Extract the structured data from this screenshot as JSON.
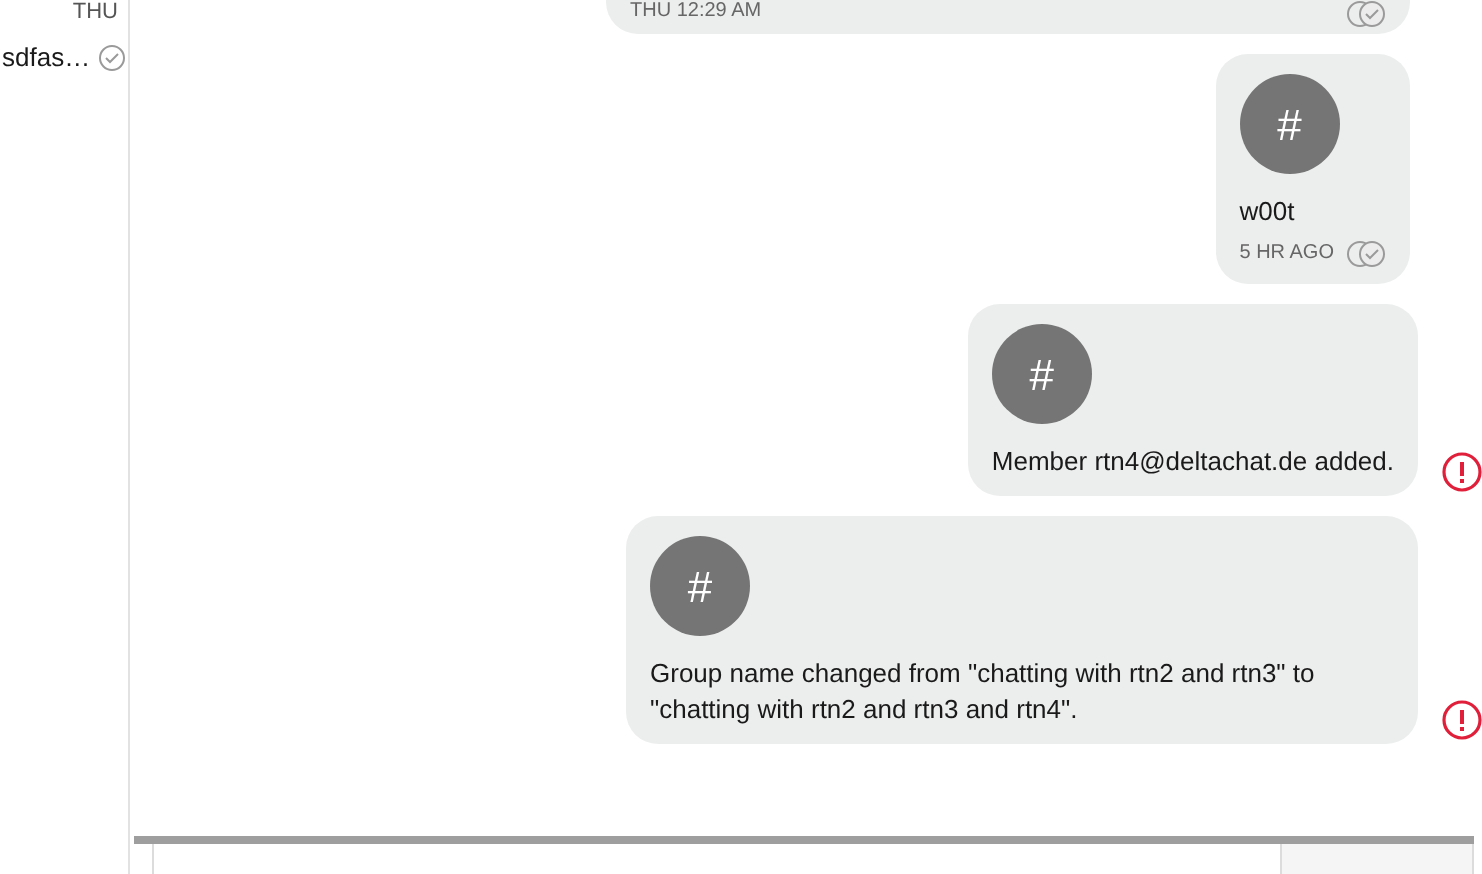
{
  "sidebar": {
    "day": "THU",
    "preview": "sdfas…",
    "delivered": true
  },
  "messages": [
    {
      "kind": "text",
      "time": "THU 12:29 AM",
      "failed": false
    },
    {
      "kind": "group_image",
      "avatar": "#",
      "text": "w00t",
      "time": "5 HR AGO",
      "failed": false
    },
    {
      "kind": "group_image",
      "avatar": "#",
      "text": "Member rtn4@deltachat.de added.",
      "failed": true
    },
    {
      "kind": "group_image",
      "avatar": "#",
      "text": "Group name changed from \"chatting with rtn2 and rtn3\" to \"chatting with rtn2 and rtn3 and rtn4\".",
      "failed": true
    }
  ]
}
